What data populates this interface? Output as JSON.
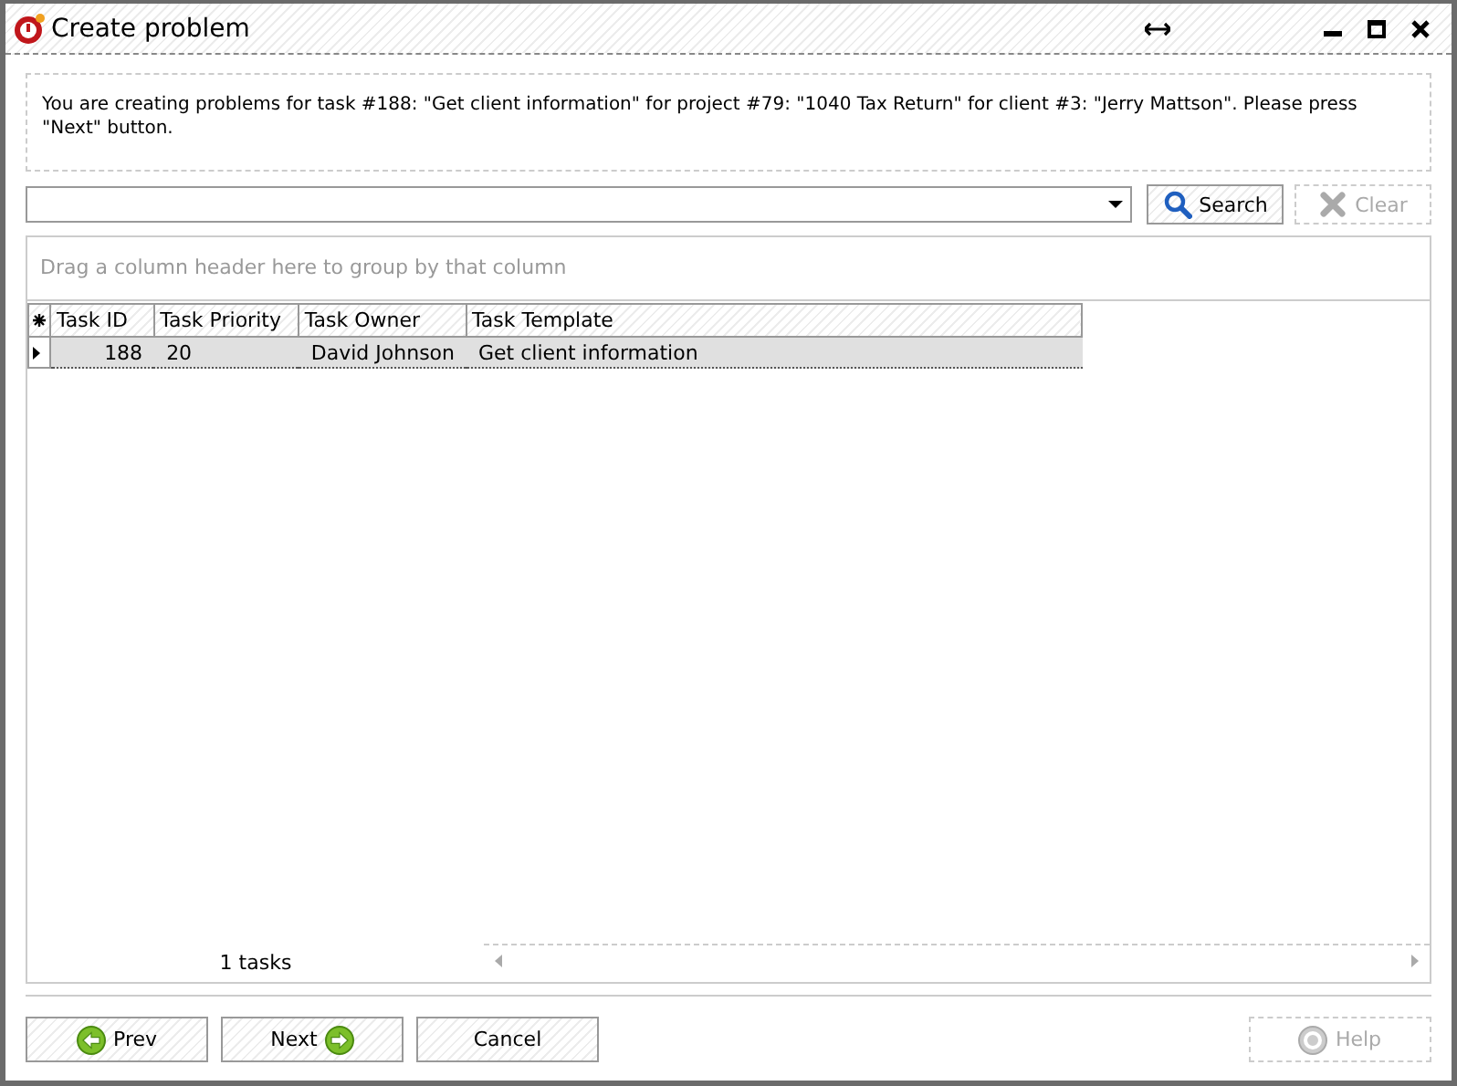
{
  "window": {
    "title": "Create problem"
  },
  "message": "You are creating problems for task #188: \"Get client information\" for project #79: \"1040 Tax Return\" for client #3: \"Jerry Mattson\". Please press \"Next\" button.",
  "search": {
    "buttons": [
      {
        "label": "Search",
        "kind": "search",
        "disabled": false
      },
      {
        "label": "Clear",
        "kind": "clear",
        "disabled": true
      }
    ]
  },
  "group_panel": {
    "placeholder": "Drag a column header here to group by that column"
  },
  "table": {
    "columns": [
      "Task ID",
      "Task Priority",
      "Task Owner",
      "Task Template"
    ],
    "rows": [
      {
        "cells": [
          "188",
          "20",
          "David Johnson",
          "Get client information"
        ],
        "selected": true
      }
    ]
  },
  "footer": {
    "count": "1 tasks"
  },
  "buttons": [
    {
      "label": "Prev",
      "kind": "prev",
      "disabled": false
    },
    {
      "label": "Next",
      "kind": "next",
      "disabled": false
    },
    {
      "label": "Cancel",
      "kind": "plain",
      "disabled": false
    },
    {
      "label": "Help",
      "kind": "help",
      "disabled": true
    }
  ]
}
